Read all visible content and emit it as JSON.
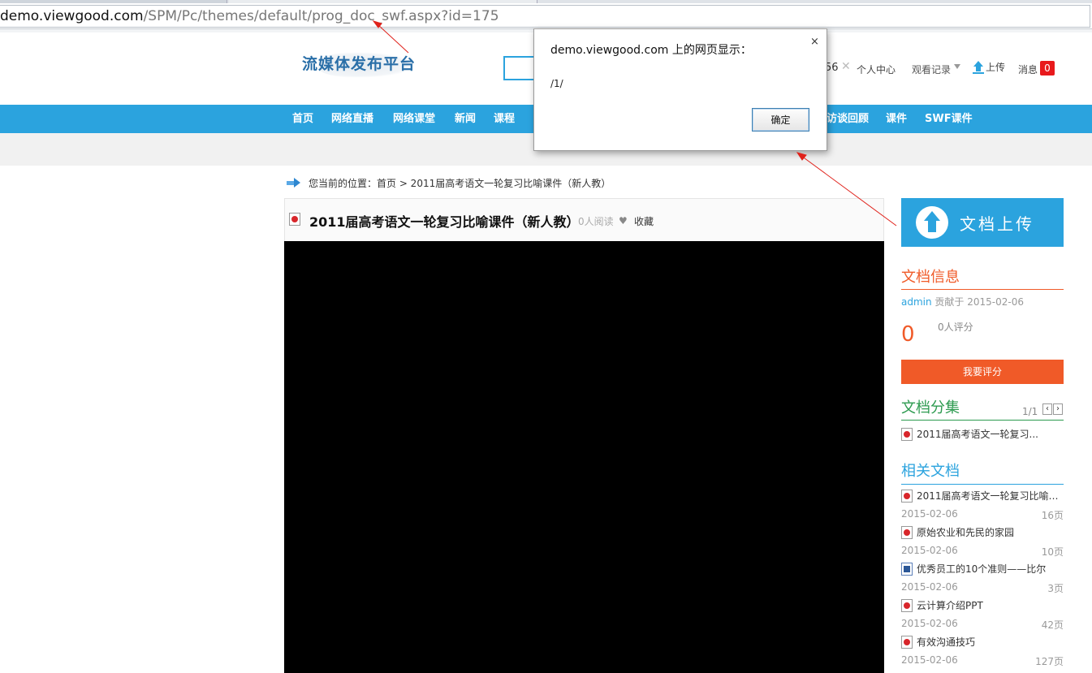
{
  "browser": {
    "url_host": "demo.viewgood.com",
    "url_path": "/SPM/Pc/themes/default/prog_doc_swf.aspx?id=175"
  },
  "header": {
    "logo_text": "流媒体发布平台",
    "user_fragment": "56",
    "user_close": "✕",
    "user_center": "个人中心",
    "history": "观看记录",
    "upload": "上传",
    "messages": "消息",
    "message_count": "0"
  },
  "nav": {
    "items": [
      "首页",
      "网络直播",
      "网络课堂",
      "新闻",
      "课程",
      "",
      "访谈回顾",
      "课件",
      "SWF课件"
    ]
  },
  "breadcrumb": {
    "text": "您当前的位置：首页 > 2011届高考语文一轮复习比喻课件（新人教）"
  },
  "doc": {
    "title": "2011届高考语文一轮复习比喻课件（新人教）",
    "reads": "0人阅读",
    "heart": "♥",
    "collect": "收藏"
  },
  "sidebar": {
    "upload_label": "文档上传",
    "info_title": "文档信息",
    "contributor": "admin",
    "contrib_text": " 贡献于 2015-02-06",
    "score": "0",
    "score_count": "0人评分",
    "rate_button": "我要评分",
    "collection_title": "文档分集",
    "pager": "1/1",
    "pager_prev": "‹",
    "pager_next": "›",
    "collection_items": [
      "2011届高考语文一轮复习..."
    ],
    "related_title": "相关文档",
    "related": [
      {
        "title": "2011届高考语文一轮复习比喻课...",
        "date": "2015-02-06",
        "pages": "16页",
        "icon": "pdf-icon"
      },
      {
        "title": "原始农业和先民的家园",
        "date": "2015-02-06",
        "pages": "10页",
        "icon": "pdf-icon"
      },
      {
        "title": "优秀员工的10个准则——比尔",
        "date": "2015-02-06",
        "pages": "3页",
        "icon": "word-icon"
      },
      {
        "title": "云计算介绍PPT",
        "date": "2015-02-06",
        "pages": "42页",
        "icon": "pdf-icon"
      },
      {
        "title": "有效沟通技巧",
        "date": "2015-02-06",
        "pages": "127页",
        "icon": "pdf-icon"
      }
    ]
  },
  "dialog": {
    "title": "demo.viewgood.com 上的网页显示：",
    "close": "×",
    "message": "/1/",
    "ok": "确定"
  },
  "colors": {
    "brand_blue": "#2ba3de",
    "accent_orange": "#f05a28",
    "section_green": "#2c9a4f",
    "annotation_red": "#e0221b"
  }
}
